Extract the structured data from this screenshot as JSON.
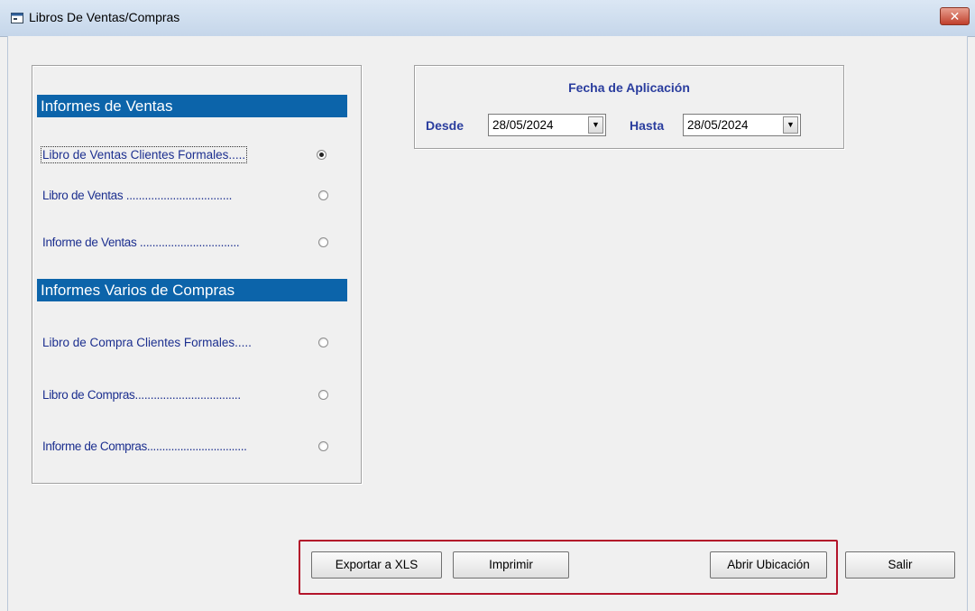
{
  "window": {
    "title": "Libros  De Ventas/Compras",
    "close_glyph": "✕",
    "app_icon": "form-icon"
  },
  "ventas": {
    "header": "Informes de Ventas",
    "options": [
      {
        "label": "Libro de Ventas Clientes Formales.....",
        "selected": true
      },
      {
        "label": "Libro de Ventas ..................................",
        "selected": false
      },
      {
        "label": "Informe de Ventas ................................",
        "selected": false
      }
    ]
  },
  "compras": {
    "header": "Informes Varios de Compras",
    "options": [
      {
        "label": "Libro de Compra Clientes Formales.....",
        "selected": false
      },
      {
        "label": "Libro de Compras..................................",
        "selected": false
      },
      {
        "label": "Informe de Compras.................................",
        "selected": false
      }
    ]
  },
  "fecha": {
    "title": "Fecha de Aplicación",
    "desde_label": "Desde",
    "desde_value": "28/05/2024",
    "hasta_label": "Hasta",
    "hasta_value": "28/05/2024",
    "dropdown_icon": "▼"
  },
  "buttons": {
    "exportar": "Exportar a XLS",
    "imprimir": "Imprimir",
    "abrir": "Abrir Ubicación",
    "salir": "Salir"
  },
  "colors": {
    "section_header_bg": "#0c64aa",
    "label_blue": "#1c2f8f",
    "highlight_red": "#b3142a"
  }
}
